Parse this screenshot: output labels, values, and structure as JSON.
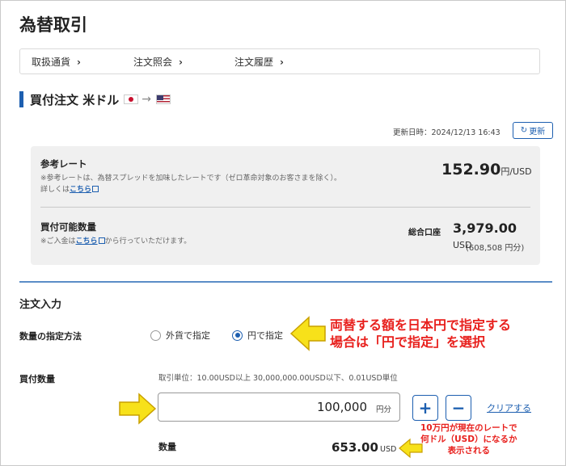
{
  "page": {
    "title": "為替取引"
  },
  "nav": {
    "items": [
      {
        "label": "取扱通貨"
      },
      {
        "label": "注文照会"
      },
      {
        "label": "注文履歴"
      }
    ],
    "chevron": "›"
  },
  "section": {
    "title": "買付注文 米ドル",
    "from_flag": "japan-flag-icon",
    "to_flag": "us-flag-icon"
  },
  "update": {
    "text": "更新日時：2024/12/13 16:43",
    "button_label": "更新"
  },
  "rate": {
    "label": "参考レート",
    "note": "※参考レートは、為替スプレッドを加味したレートです（ゼロ革命対象のお客さまを除く）。",
    "detail_prefix": "詳しくは",
    "detail_link": "こちら",
    "value": "152.90",
    "unit": "円/USD"
  },
  "available": {
    "label": "買付可能数量",
    "note_prefix": "※ご入金は",
    "note_link": "こちら",
    "note_suffix": "から行っていただけます。",
    "account_label": "総合口座",
    "value": "3,979.00",
    "unit": "USD",
    "yen": "(608,508 円分)"
  },
  "order": {
    "title": "注文入力",
    "method_label": "数量の指定方法",
    "options": [
      {
        "label": "外貨で指定",
        "selected": false
      },
      {
        "label": "円で指定",
        "selected": true
      }
    ],
    "amount_label": "買付数量",
    "unit_note": "取引単位：10.00USD以上 30,000,000.00USD以下、0.01USD単位",
    "amount_value": "100,000",
    "amount_unit": "円分",
    "plus": "+",
    "minus": "−",
    "clear_label": "クリアする",
    "qty_label": "数量",
    "qty_value": "653.00",
    "qty_unit": "USD"
  },
  "annotations": {
    "callout1_line1": "両替する額を日本円で指定する",
    "callout1_line2": "場合は「円で指定」を選択",
    "callout2_line1": "10万円が現在のレートで",
    "callout2_line2": "何ドル（USD）になるか",
    "callout2_line3": "表示される"
  },
  "colors": {
    "accent": "#1d5fb0",
    "callout": "#e8201d",
    "arrow": "#f7e11a"
  }
}
